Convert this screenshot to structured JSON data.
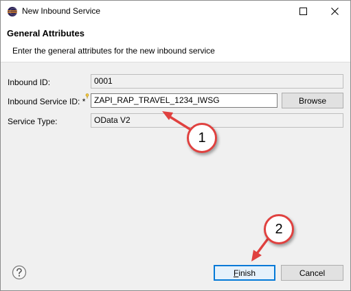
{
  "window": {
    "title": "New Inbound Service"
  },
  "header": {
    "title": "General Attributes",
    "description": "Enter the general attributes for the new inbound service"
  },
  "form": {
    "inbound_id": {
      "label": "Inbound ID:",
      "value": "0001"
    },
    "service_id": {
      "label": "Inbound Service ID: *",
      "value": "ZAPI_RAP_TRAVEL_1234_IWSG"
    },
    "service_type": {
      "label": "Service Type:",
      "value": "OData V2"
    },
    "browse_label": "Browse"
  },
  "footer": {
    "finish_label_mnemonic": "F",
    "finish_label_rest": "inish",
    "cancel_label": "Cancel"
  },
  "callouts": {
    "one": "1",
    "two": "2"
  },
  "colors": {
    "accent": "#0078d7",
    "callout_red": "#e0413f"
  }
}
